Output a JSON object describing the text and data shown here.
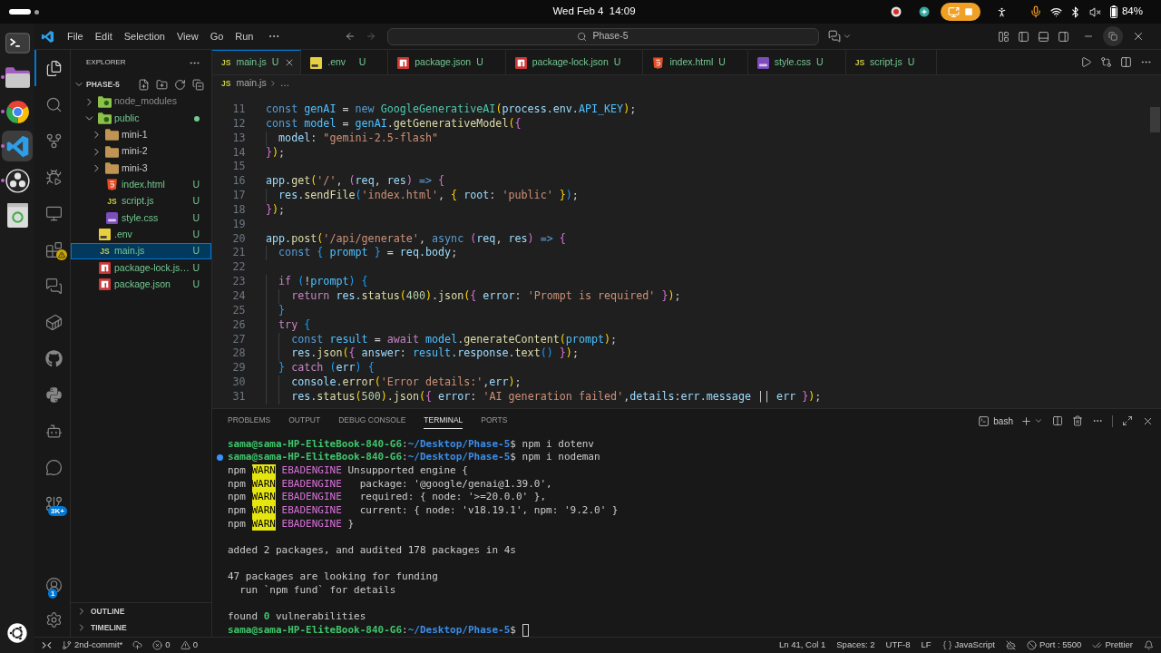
{
  "top_bar": {
    "clock": "Wed Feb 4  14:09",
    "battery": "84%"
  },
  "dock": [
    {
      "kind": "terminal",
      "running": false,
      "selected": false
    },
    {
      "kind": "files",
      "running": true,
      "selected": false
    },
    {
      "kind": "browser",
      "running": true,
      "selected": false
    },
    {
      "kind": "code-editor",
      "running": true,
      "selected": true
    },
    {
      "kind": "recorder",
      "running": true,
      "selected": false
    },
    {
      "kind": "trash",
      "running": false,
      "selected": false
    }
  ],
  "title_bar": {
    "menu": [
      "File",
      "Edit",
      "Selection",
      "View",
      "Go",
      "Run"
    ],
    "command_center": "Phase-5"
  },
  "activity_bar": {
    "top": [
      {
        "kind": "explorer",
        "selected": true
      },
      {
        "kind": "search",
        "selected": false
      },
      {
        "kind": "source-control",
        "selected": false
      },
      {
        "kind": "run-debug",
        "selected": false
      },
      {
        "kind": "remote",
        "selected": false
      },
      {
        "kind": "extensions",
        "selected": false,
        "badge": {
          "kind": "warning"
        }
      },
      {
        "kind": "chat",
        "selected": false
      },
      {
        "kind": "containers",
        "selected": false
      },
      {
        "kind": "github",
        "selected": false
      },
      {
        "kind": "python",
        "selected": false
      },
      {
        "kind": "bot",
        "selected": false
      },
      {
        "kind": "bubble",
        "selected": false
      },
      {
        "kind": "git-graph",
        "selected": false,
        "badge": {
          "kind": "count",
          "text": "3K+"
        }
      }
    ],
    "bottom": [
      {
        "kind": "accounts",
        "badge": {
          "kind": "count",
          "text": "1"
        }
      },
      {
        "kind": "settings"
      }
    ]
  },
  "sidebar": {
    "title": "EXPLORER",
    "folder": "PHASE-5",
    "tree": [
      {
        "name": "node_modules",
        "kind": "folder-node",
        "untracked": false,
        "ignored": true,
        "expanded": false,
        "selected": false
      },
      {
        "name": "public",
        "kind": "folder-public",
        "untracked": true,
        "ignored": false,
        "expanded": true,
        "selected": false,
        "children": [
          {
            "name": "mini-1",
            "kind": "folder",
            "untracked": false,
            "ignored": false,
            "expanded": false,
            "selected": false
          },
          {
            "name": "mini-2",
            "kind": "folder",
            "untracked": false,
            "ignored": false,
            "expanded": false,
            "selected": false
          },
          {
            "name": "mini-3",
            "kind": "folder",
            "untracked": false,
            "ignored": false,
            "expanded": false,
            "selected": false
          },
          {
            "name": "index.html",
            "kind": "html",
            "untracked": true,
            "ignored": false,
            "badge": "U",
            "selected": false
          },
          {
            "name": "script.js",
            "kind": "js",
            "icon_label": "JS",
            "untracked": true,
            "ignored": false,
            "badge": "U",
            "selected": false
          },
          {
            "name": "style.css",
            "kind": "css",
            "untracked": true,
            "ignored": false,
            "badge": "U",
            "selected": false
          }
        ]
      },
      {
        "name": ".env",
        "kind": "env",
        "untracked": true,
        "ignored": false,
        "badge": "U",
        "selected": false
      },
      {
        "name": "main.js",
        "kind": "js",
        "icon_label": "JS",
        "untracked": true,
        "ignored": false,
        "badge": "U",
        "selected": true
      },
      {
        "name": "package-lock.js…",
        "kind": "npm",
        "untracked": true,
        "ignored": false,
        "badge": "U",
        "selected": false
      },
      {
        "name": "package.json",
        "kind": "npm",
        "untracked": true,
        "ignored": false,
        "badge": "U",
        "selected": false
      }
    ],
    "sections": [
      "OUTLINE",
      "TIMELINE"
    ]
  },
  "editor": {
    "tabs": [
      {
        "label": "main.js",
        "kind": "js",
        "icon_label": "JS",
        "badge": "U",
        "selected": true
      },
      {
        "label": ".env",
        "kind": "env",
        "badge": "U",
        "selected": false
      },
      {
        "label": "package.json",
        "kind": "npm",
        "badge": "U",
        "selected": false
      },
      {
        "label": "package-lock.json",
        "kind": "npm",
        "badge": "U",
        "selected": false
      },
      {
        "label": "index.html",
        "kind": "html",
        "badge": "U",
        "selected": false
      },
      {
        "label": "style.css",
        "kind": "css",
        "badge": "U",
        "selected": false
      },
      {
        "label": "script.js",
        "kind": "js",
        "icon_label": "JS",
        "badge": "U",
        "selected": false
      }
    ],
    "breadcrumb": {
      "icon_label": "JS",
      "file": "main.js",
      "symbol": "…"
    },
    "lines": [
      {
        "number": "11",
        "tokens": [
          {
            "text": "const ",
            "kind": "kw"
          },
          {
            "text": "genAI",
            "kind": "cvar"
          },
          {
            "text": " = ",
            "kind": "p"
          },
          {
            "text": "new ",
            "kind": "kw"
          },
          {
            "text": "GoogleGenerativeAI",
            "kind": "cls"
          },
          {
            "text": "(",
            "kind": "b1"
          },
          {
            "text": "process.env.",
            "kind": "var"
          },
          {
            "text": "API_KEY",
            "kind": "cvar"
          },
          {
            "text": ")",
            "kind": "b1"
          },
          {
            "text": ";",
            "kind": "p"
          }
        ]
      },
      {
        "number": "12",
        "tokens": [
          {
            "text": "const ",
            "kind": "kw"
          },
          {
            "text": "model",
            "kind": "cvar"
          },
          {
            "text": " = ",
            "kind": "p"
          },
          {
            "text": "genAI",
            "kind": "cvar"
          },
          {
            "text": ".",
            "kind": "p"
          },
          {
            "text": "getGenerativeModel",
            "kind": "fn"
          },
          {
            "text": "(",
            "kind": "b1"
          },
          {
            "text": "{",
            "kind": "b2"
          }
        ]
      },
      {
        "number": "13",
        "tokens": [
          {
            "text": "  model",
            "kind": "var"
          },
          {
            "text": ": ",
            "kind": "p"
          },
          {
            "text": "\"gemini-2.5-flash\"",
            "kind": "str"
          }
        ]
      },
      {
        "number": "14",
        "tokens": [
          {
            "text": "}",
            "kind": "b2"
          },
          {
            "text": ")",
            "kind": "b1"
          },
          {
            "text": ";",
            "kind": "p"
          }
        ]
      },
      {
        "number": "15"
      },
      {
        "number": "16",
        "tokens": [
          {
            "text": "app.",
            "kind": "var"
          },
          {
            "text": "get",
            "kind": "fn"
          },
          {
            "text": "(",
            "kind": "b1"
          },
          {
            "text": "'/'",
            "kind": "str"
          },
          {
            "text": ", ",
            "kind": "p"
          },
          {
            "text": "(",
            "kind": "b2"
          },
          {
            "text": "req",
            "kind": "var"
          },
          {
            "text": ", ",
            "kind": "p"
          },
          {
            "text": "res",
            "kind": "var"
          },
          {
            "text": ")",
            "kind": "b2"
          },
          {
            "text": " => ",
            "kind": "kw"
          },
          {
            "text": "{",
            "kind": "b2"
          }
        ]
      },
      {
        "number": "17",
        "tokens": [
          {
            "text": "  res.",
            "kind": "var"
          },
          {
            "text": "sendFile",
            "kind": "fn"
          },
          {
            "text": "(",
            "kind": "b3"
          },
          {
            "text": "'index.html'",
            "kind": "str"
          },
          {
            "text": ", ",
            "kind": "p"
          },
          {
            "text": "{",
            "kind": "b1"
          },
          {
            "text": " root",
            "kind": "var"
          },
          {
            "text": ": ",
            "kind": "p"
          },
          {
            "text": "'public' ",
            "kind": "str"
          },
          {
            "text": "}",
            "kind": "b1"
          },
          {
            "text": ")",
            "kind": "b3"
          },
          {
            "text": ";",
            "kind": "p"
          }
        ]
      },
      {
        "number": "18",
        "tokens": [
          {
            "text": "}",
            "kind": "b2"
          },
          {
            "text": ")",
            "kind": "b1"
          },
          {
            "text": ";",
            "kind": "p"
          }
        ]
      },
      {
        "number": "19"
      },
      {
        "number": "20",
        "tokens": [
          {
            "text": "app.",
            "kind": "var"
          },
          {
            "text": "post",
            "kind": "fn"
          },
          {
            "text": "(",
            "kind": "b1"
          },
          {
            "text": "'/api/generate'",
            "kind": "str"
          },
          {
            "text": ", ",
            "kind": "p"
          },
          {
            "text": "async ",
            "kind": "kw"
          },
          {
            "text": "(",
            "kind": "b2"
          },
          {
            "text": "req",
            "kind": "var"
          },
          {
            "text": ", ",
            "kind": "p"
          },
          {
            "text": "res",
            "kind": "var"
          },
          {
            "text": ")",
            "kind": "b2"
          },
          {
            "text": " => ",
            "kind": "kw"
          },
          {
            "text": "{",
            "kind": "b2"
          }
        ]
      },
      {
        "number": "21",
        "tokens": [
          {
            "text": "  const ",
            "kind": "kw"
          },
          {
            "text": "{",
            "kind": "b3"
          },
          {
            "text": " prompt ",
            "kind": "cvar"
          },
          {
            "text": "}",
            "kind": "b3"
          },
          {
            "text": " = ",
            "kind": "p"
          },
          {
            "text": "req.body",
            "kind": "var"
          },
          {
            "text": ";",
            "kind": "p"
          }
        ]
      },
      {
        "number": "22"
      },
      {
        "number": "23",
        "tokens": [
          {
            "text": "  if ",
            "kind": "ctl"
          },
          {
            "text": "(",
            "kind": "b3"
          },
          {
            "text": "!",
            "kind": "p"
          },
          {
            "text": "prompt",
            "kind": "cvar"
          },
          {
            "text": ") {",
            "kind": "b3"
          }
        ]
      },
      {
        "number": "24",
        "tokens": [
          {
            "text": "    return ",
            "kind": "ctl"
          },
          {
            "text": "res.",
            "kind": "var"
          },
          {
            "text": "status",
            "kind": "fn"
          },
          {
            "text": "(",
            "kind": "b1"
          },
          {
            "text": "400",
            "kind": "num"
          },
          {
            "text": ")",
            "kind": "b1"
          },
          {
            "text": ".",
            "kind": "p"
          },
          {
            "text": "json",
            "kind": "fn"
          },
          {
            "text": "(",
            "kind": "b1"
          },
          {
            "text": "{",
            "kind": "b2"
          },
          {
            "text": " error",
            "kind": "var"
          },
          {
            "text": ": ",
            "kind": "p"
          },
          {
            "text": "'Prompt is required' ",
            "kind": "str"
          },
          {
            "text": "}",
            "kind": "b2"
          },
          {
            "text": ")",
            "kind": "b1"
          },
          {
            "text": ";",
            "kind": "p"
          }
        ]
      },
      {
        "number": "25",
        "tokens": [
          {
            "text": "  }",
            "kind": "b3"
          }
        ]
      },
      {
        "number": "26",
        "tokens": [
          {
            "text": "  try ",
            "kind": "ctl"
          },
          {
            "text": "{",
            "kind": "b3"
          }
        ]
      },
      {
        "number": "27",
        "tokens": [
          {
            "text": "    const ",
            "kind": "kw"
          },
          {
            "text": "result",
            "kind": "cvar"
          },
          {
            "text": " = ",
            "kind": "p"
          },
          {
            "text": "await ",
            "kind": "ctl"
          },
          {
            "text": "model",
            "kind": "cvar"
          },
          {
            "text": ".",
            "kind": "p"
          },
          {
            "text": "generateContent",
            "kind": "fn"
          },
          {
            "text": "(",
            "kind": "b1"
          },
          {
            "text": "prompt",
            "kind": "cvar"
          },
          {
            "text": ")",
            "kind": "b1"
          },
          {
            "text": ";",
            "kind": "p"
          }
        ]
      },
      {
        "number": "28",
        "tokens": [
          {
            "text": "    res.",
            "kind": "var"
          },
          {
            "text": "json",
            "kind": "fn"
          },
          {
            "text": "(",
            "kind": "b1"
          },
          {
            "text": "{",
            "kind": "b2"
          },
          {
            "text": " answer",
            "kind": "var"
          },
          {
            "text": ": ",
            "kind": "p"
          },
          {
            "text": "result",
            "kind": "cvar"
          },
          {
            "text": ".response.",
            "kind": "var"
          },
          {
            "text": "text",
            "kind": "fn"
          },
          {
            "text": "() ",
            "kind": "b3"
          },
          {
            "text": "}",
            "kind": "b2"
          },
          {
            "text": ")",
            "kind": "b1"
          },
          {
            "text": ";",
            "kind": "p"
          }
        ]
      },
      {
        "number": "29",
        "tokens": [
          {
            "text": "  }",
            "kind": "b3"
          },
          {
            "text": " catch ",
            "kind": "ctl"
          },
          {
            "text": "(",
            "kind": "b3"
          },
          {
            "text": "err",
            "kind": "var"
          },
          {
            "text": ") {",
            "kind": "b3"
          }
        ]
      },
      {
        "number": "30",
        "tokens": [
          {
            "text": "    console.",
            "kind": "var"
          },
          {
            "text": "error",
            "kind": "fn"
          },
          {
            "text": "(",
            "kind": "b1"
          },
          {
            "text": "'Error details:'",
            "kind": "str"
          },
          {
            "text": ",",
            "kind": "p"
          },
          {
            "text": "err",
            "kind": "var"
          },
          {
            "text": ")",
            "kind": "b1"
          },
          {
            "text": ";",
            "kind": "p"
          }
        ]
      },
      {
        "number": "31",
        "tokens": [
          {
            "text": "    res.",
            "kind": "var"
          },
          {
            "text": "status",
            "kind": "fn"
          },
          {
            "text": "(",
            "kind": "b1"
          },
          {
            "text": "500",
            "kind": "num"
          },
          {
            "text": ")",
            "kind": "b1"
          },
          {
            "text": ".",
            "kind": "p"
          },
          {
            "text": "json",
            "kind": "fn"
          },
          {
            "text": "(",
            "kind": "b1"
          },
          {
            "text": "{",
            "kind": "b2"
          },
          {
            "text": " error",
            "kind": "var"
          },
          {
            "text": ": ",
            "kind": "p"
          },
          {
            "text": "'AI generation failed'",
            "kind": "str"
          },
          {
            "text": ",",
            "kind": "p"
          },
          {
            "text": "details",
            "kind": "var"
          },
          {
            "text": ":",
            "kind": "p"
          },
          {
            "text": "err.message",
            "kind": "var"
          },
          {
            "text": " || ",
            "kind": "p"
          },
          {
            "text": "err ",
            "kind": "var"
          },
          {
            "text": "}",
            "kind": "b2"
          },
          {
            "text": ")",
            "kind": "b1"
          },
          {
            "text": ";",
            "kind": "p"
          }
        ]
      }
    ]
  },
  "panel": {
    "tabs": [
      {
        "label": "PROBLEMS",
        "selected": false
      },
      {
        "label": "OUTPUT",
        "selected": false
      },
      {
        "label": "DEBUG CONSOLE",
        "selected": false
      },
      {
        "label": "TERMINAL",
        "selected": true
      },
      {
        "label": "PORTS",
        "selected": false
      }
    ],
    "shell": "bash",
    "terminal": [
      {
        "lines": [
          {
            "tokens": [
              {
                "text": "sama@sama-HP-EliteBook-840-G6",
                "kind": "user"
              },
              {
                "text": ":",
                "kind": "p"
              },
              {
                "text": "~/Desktop/Phase-5",
                "kind": "path"
              },
              {
                "text": "$ npm i dotenv",
                "kind": "p"
              }
            ]
          },
          {
            "decorated": true,
            "tokens": [
              {
                "text": "sama@sama-HP-EliteBook-840-G6",
                "kind": "user"
              },
              {
                "text": ":",
                "kind": "p"
              },
              {
                "text": "~/Desktop/Phase-5",
                "kind": "path"
              },
              {
                "text": "$ npm i nodeman",
                "kind": "p"
              }
            ]
          },
          {
            "tokens": [
              {
                "text": "npm ",
                "kind": "p"
              },
              {
                "text": "WARN",
                "kind": "warn"
              },
              {
                "text": " EBADENGINE",
                "kind": "engine"
              },
              {
                "text": " Unsupported engine {",
                "kind": "p"
              }
            ]
          },
          {
            "tokens": [
              {
                "text": "npm ",
                "kind": "p"
              },
              {
                "text": "WARN",
                "kind": "warn"
              },
              {
                "text": " EBADENGINE",
                "kind": "engine"
              },
              {
                "text": "   package: '@google/genai@1.39.0',",
                "kind": "p"
              }
            ]
          },
          {
            "tokens": [
              {
                "text": "npm ",
                "kind": "p"
              },
              {
                "text": "WARN",
                "kind": "warn"
              },
              {
                "text": " EBADENGINE",
                "kind": "engine"
              },
              {
                "text": "   required: { node: '>=20.0.0' },",
                "kind": "p"
              }
            ]
          },
          {
            "tokens": [
              {
                "text": "npm ",
                "kind": "p"
              },
              {
                "text": "WARN",
                "kind": "warn"
              },
              {
                "text": " EBADENGINE",
                "kind": "engine"
              },
              {
                "text": "   current: { node: 'v18.19.1', npm: '9.2.0' }",
                "kind": "p"
              }
            ]
          },
          {
            "tokens": [
              {
                "text": "npm ",
                "kind": "p"
              },
              {
                "text": "WARN",
                "kind": "warn"
              },
              {
                "text": " EBADENGINE",
                "kind": "engine"
              },
              {
                "text": " }",
                "kind": "p"
              }
            ]
          }
        ]
      },
      {
        "lines": [
          {
            "tokens": [
              {
                "text": "added 2 packages, and audited 178 packages in 4s",
                "kind": "p"
              }
            ]
          }
        ]
      },
      {
        "lines": [
          {
            "tokens": [
              {
                "text": "47 packages are looking for funding",
                "kind": "p"
              }
            ]
          },
          {
            "tokens": [
              {
                "text": "  run `npm fund` for details",
                "kind": "p"
              }
            ]
          }
        ]
      },
      {
        "lines": [
          {
            "tokens": [
              {
                "text": "found ",
                "kind": "p"
              },
              {
                "text": "0",
                "kind": "ok"
              },
              {
                "text": " vulnerabilities",
                "kind": "p"
              }
            ]
          },
          {
            "cursor": true,
            "tokens": [
              {
                "text": "sama@sama-HP-EliteBook-840-G6",
                "kind": "user"
              },
              {
                "text": ":",
                "kind": "p"
              },
              {
                "text": "~/Desktop/Phase-5",
                "kind": "path"
              },
              {
                "text": "$ ",
                "kind": "p"
              }
            ]
          }
        ]
      }
    ]
  },
  "status_bar": {
    "left": [
      {
        "kind": "remote"
      },
      {
        "kind": "branch",
        "text": "2nd-commit*"
      },
      {
        "kind": "sync"
      },
      {
        "kind": "error",
        "text": "0"
      },
      {
        "kind": "warning",
        "text": "0"
      }
    ],
    "right": [
      {
        "kind": "plain",
        "text": "Ln 41, Col 1"
      },
      {
        "kind": "plain",
        "text": "Spaces: 2"
      },
      {
        "kind": "plain",
        "text": "UTF-8"
      },
      {
        "kind": "plain",
        "text": "LF"
      },
      {
        "kind": "braces",
        "text": "JavaScript"
      },
      {
        "kind": "copilot"
      },
      {
        "kind": "ban",
        "text": "Port : 5500"
      },
      {
        "kind": "check-all",
        "text": "Prettier"
      },
      {
        "kind": "bell"
      }
    ]
  }
}
